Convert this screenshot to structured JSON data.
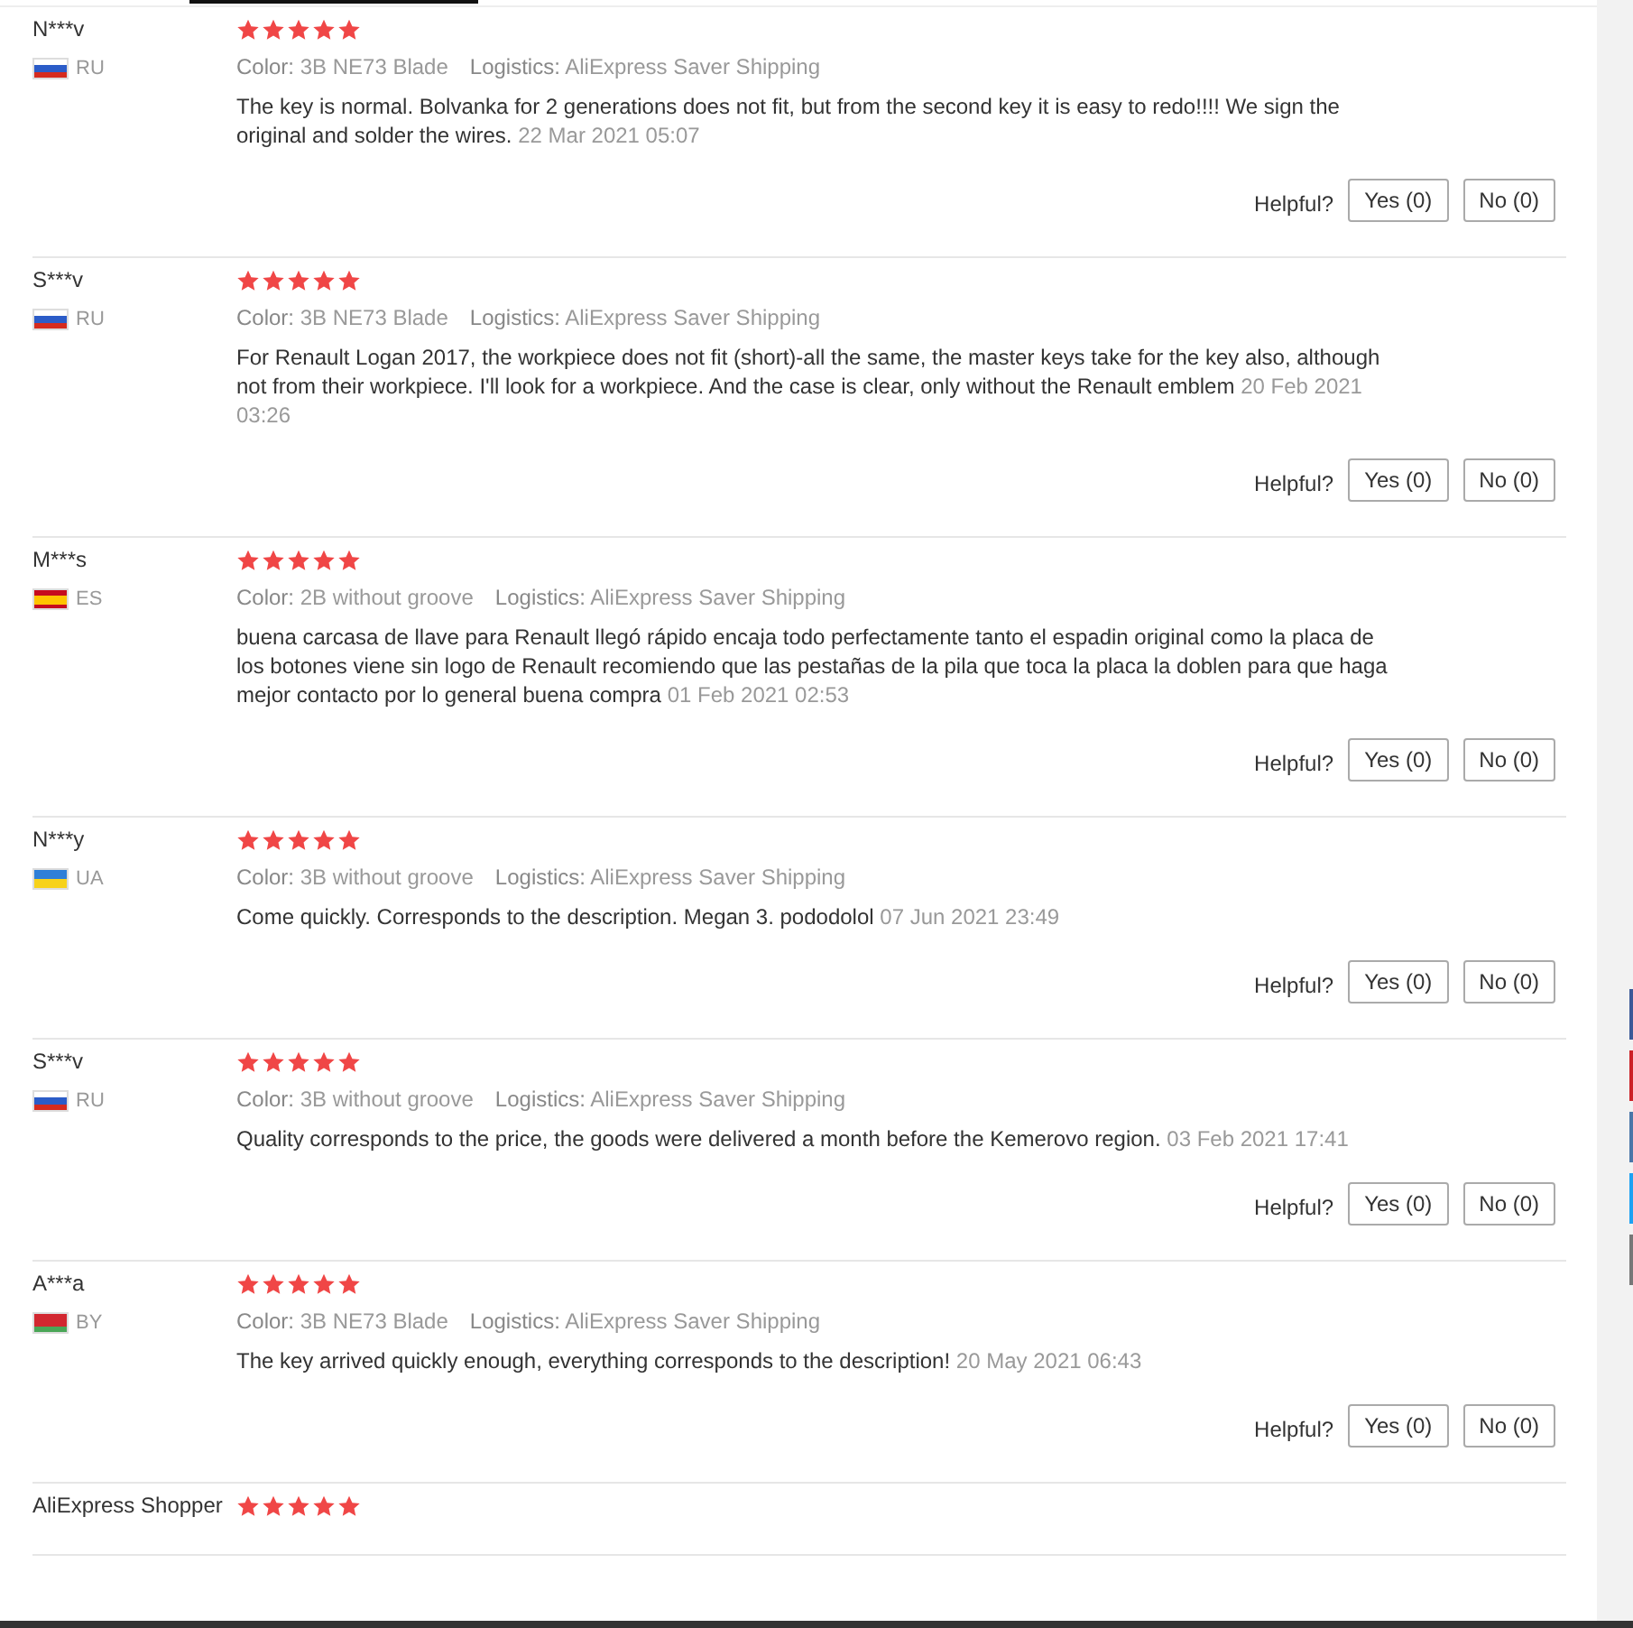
{
  "reviews": [
    {
      "name": "N***v",
      "kind": "ru",
      "country": "RU",
      "stars": 5,
      "variant": "**Color:** 3B NE73 Blade",
      "logistics": "**Logistics:** AliExpress Saver Shipping",
      "text": "The key is normal. Bolvanka for 2 generations does not fit, but from the second key it is easy to redo!!!! We sign the original and solder the wires.",
      "date": "22 Mar 2021 05:07",
      "helpful": "Helpful?",
      "yes": "Yes (0)",
      "no": "No (0)"
    },
    {
      "name": "S***v",
      "kind": "ru",
      "country": "RU",
      "stars": 5,
      "variant": "**Color:** 3B NE73 Blade",
      "logistics": "**Logistics:** AliExpress Saver Shipping",
      "text": "For Renault Logan 2017, the workpiece does not fit (short)-all the same, the master keys take for the key also, although not from their workpiece. I'll look for a workpiece. And the case is clear, only without the Renault emblem",
      "date": "20 Feb 2021 03:26",
      "helpful": "Helpful?",
      "yes": "Yes (0)",
      "no": "No (0)"
    },
    {
      "name": "M***s",
      "kind": "es",
      "country": "ES",
      "stars": 5,
      "variant": "**Color:** 2B without groove",
      "logistics": "**Logistics:** AliExpress Saver Shipping",
      "text": "buena carcasa de llave para Renault llegó rápido encaja todo perfectamente tanto el espadin original como la placa de los botones viene sin logo de Renault recomiendo que las pestañas de la pila que toca la placa la doblen para que haga mejor contacto por lo general buena compra",
      "date": "01 Feb 2021 02:53",
      "helpful": "Helpful?",
      "yes": "Yes (0)",
      "no": "No (0)"
    },
    {
      "name": "N***y",
      "kind": "ua",
      "country": "UA",
      "stars": 5,
      "variant": "**Color:** 3B without groove",
      "logistics": "**Logistics:** AliExpress Saver Shipping",
      "text": "Come quickly. Corresponds to the description. Megan 3. pododolol",
      "date": "07 Jun 2021 23:49",
      "helpful": "Helpful?",
      "yes": "Yes (0)",
      "no": "No (0)"
    },
    {
      "name": "S***v",
      "kind": "ru",
      "country": "RU",
      "stars": 5,
      "variant": "**Color:** 3B without groove",
      "logistics": "**Logistics:** AliExpress Saver Shipping",
      "text": "Quality corresponds to the price, the goods were delivered a month before the Kemerovo region.",
      "date": "03 Feb 2021 17:41",
      "helpful": "Helpful?",
      "yes": "Yes (0)",
      "no": "No (0)"
    },
    {
      "name": "A***a",
      "kind": "by",
      "country": "BY",
      "stars": 5,
      "variant": "**Color:** 3B NE73 Blade",
      "logistics": "**Logistics:** AliExpress Saver Shipping",
      "text": "The key arrived quickly enough, everything corresponds to the description!",
      "date": "20 May 2021 06:43",
      "helpful": "Helpful?",
      "yes": "Yes (0)",
      "no": "No (0)"
    },
    {
      "name": "AliExpress Shopper",
      "stars": 5
    }
  ],
  "share_tabs": [
    {
      "color": "#3b5998"
    },
    {
      "color": "#cc2127"
    },
    {
      "color": "#4a76a8"
    },
    {
      "color": "#1da1f2"
    },
    {
      "color": "#777777"
    }
  ]
}
